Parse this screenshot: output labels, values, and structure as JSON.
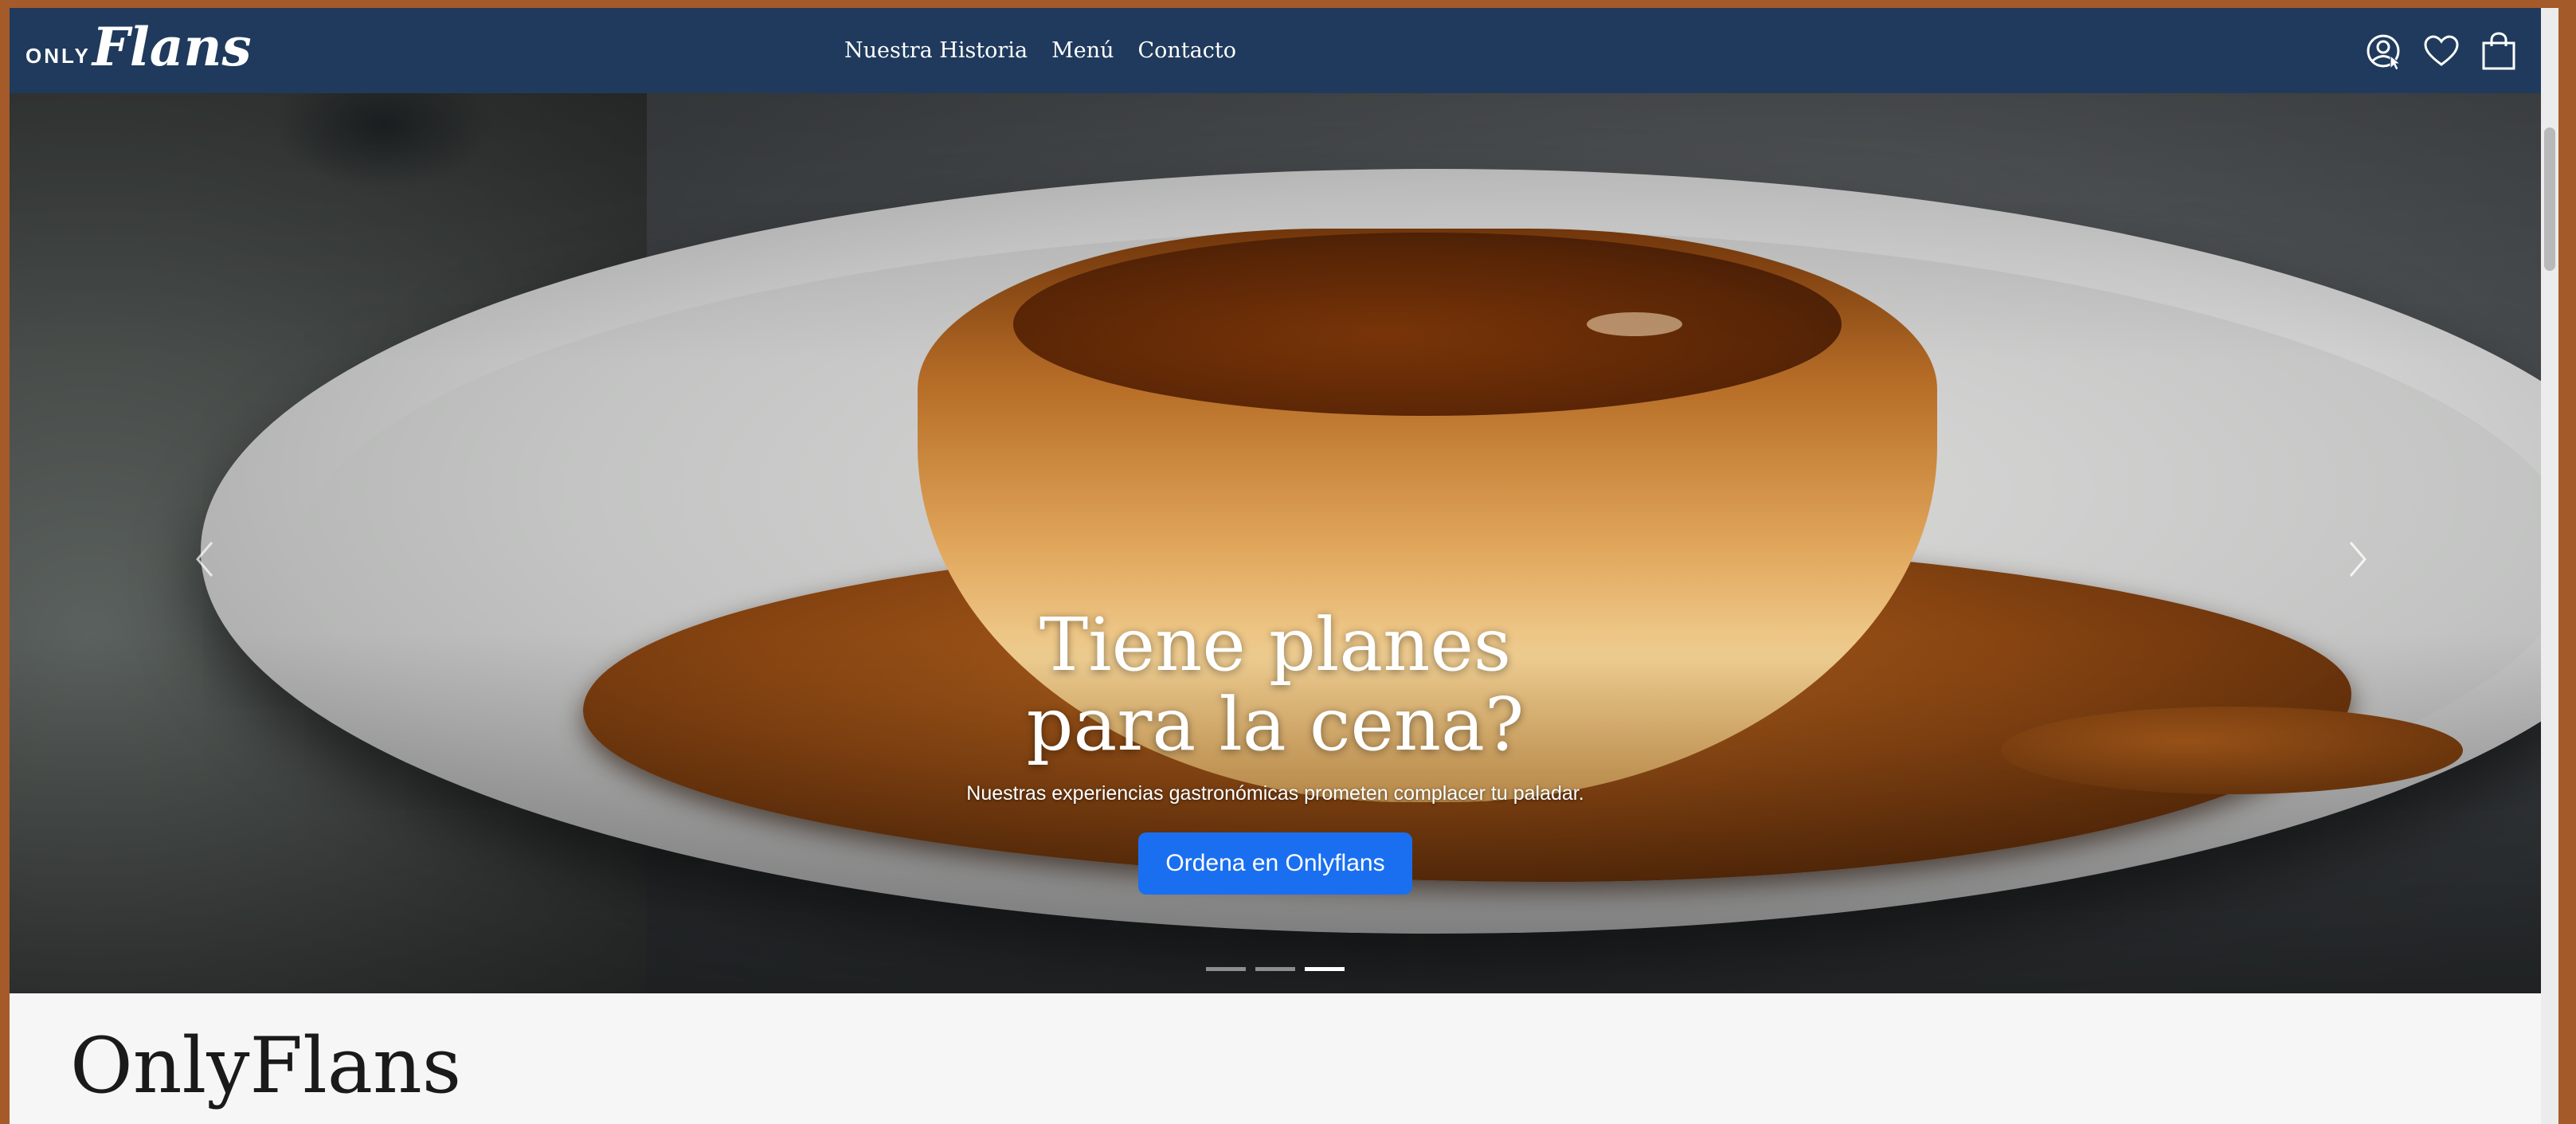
{
  "brand": {
    "small": "ONLY",
    "script": "Flans"
  },
  "nav": {
    "links": [
      "Nuestra Historia",
      "Menú",
      "Contacto"
    ]
  },
  "icons": {
    "account": "user-circle-icon",
    "wishlist": "heart-icon",
    "cart": "shopping-bag-icon"
  },
  "hero": {
    "title_line1": "Tiene planes",
    "title_line2": "para la cena?",
    "subtitle": "Nuestras experiencias gastronómicas prometen complacer tu paladar.",
    "button_label": "Ordena en Onlyflans",
    "slides_total": 3,
    "active_slide": 3
  },
  "section": {
    "title": "OnlyFlans"
  },
  "colors": {
    "navbar": "#1f3a5c",
    "button": "#1a6ff0",
    "frame": "#a55a2a",
    "page_bg": "#f6f6f6"
  }
}
